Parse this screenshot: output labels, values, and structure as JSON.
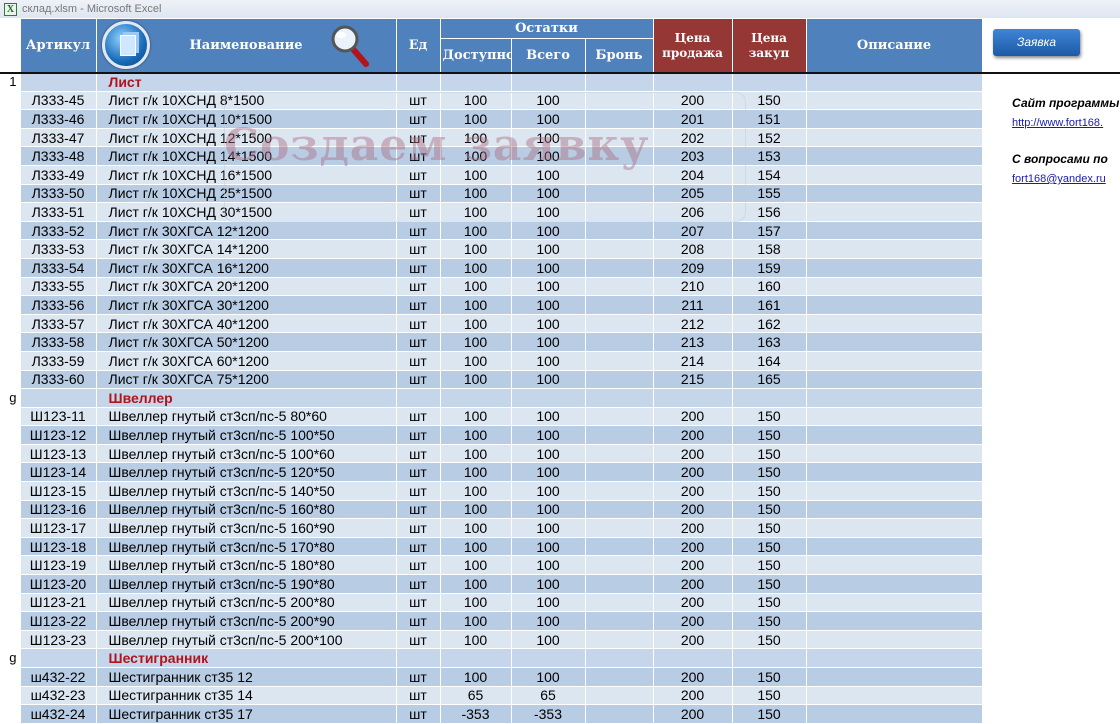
{
  "window": {
    "title": "склад.xlsm - Microsoft Excel",
    "icon": "excel-icon"
  },
  "header": {
    "article": "Артикул",
    "name": "Наименование",
    "unit": "Ед",
    "stock": "Остатки",
    "available": "Доступно",
    "total": "Всего",
    "reserve": "Бронь",
    "price_sell": "Цена продажа",
    "price_buy": "Цена закуп",
    "description": "Описание"
  },
  "watermark": "Создаем заявку",
  "side": {
    "order_button": "Заявка",
    "site_label": "Сайт программы",
    "site_link": "http://www.fort168.",
    "questions_label": "С вопросами по",
    "email": "fort168@yandex.ru"
  },
  "groups": [
    {
      "num": "1",
      "title": "Лист",
      "rows": [
        [
          "Л333-45",
          "Лист г/к  10ХСНД 8*1500",
          "шт",
          "100",
          "100",
          "",
          "200",
          "150"
        ],
        [
          "Л333-46",
          "Лист г/к  10ХСНД 10*1500",
          "шт",
          "100",
          "100",
          "",
          "201",
          "151"
        ],
        [
          "Л333-47",
          "Лист г/к  10ХСНД 12*1500",
          "шт",
          "100",
          "100",
          "",
          "202",
          "152"
        ],
        [
          "Л333-48",
          "Лист г/к  10ХСНД 14*1500",
          "шт",
          "100",
          "100",
          "",
          "203",
          "153"
        ],
        [
          "Л333-49",
          "Лист г/к  10ХСНД 16*1500",
          "шт",
          "100",
          "100",
          "",
          "204",
          "154"
        ],
        [
          "Л333-50",
          "Лист г/к  10ХСНД 25*1500",
          "шт",
          "100",
          "100",
          "",
          "205",
          "155"
        ],
        [
          "Л333-51",
          "Лист г/к  10ХСНД 30*1500",
          "шт",
          "100",
          "100",
          "",
          "206",
          "156"
        ],
        [
          "Л333-52",
          "Лист г/к  30ХГСА 12*1200",
          "шт",
          "100",
          "100",
          "",
          "207",
          "157"
        ],
        [
          "Л333-53",
          "Лист г/к  30ХГСА 14*1200",
          "шт",
          "100",
          "100",
          "",
          "208",
          "158"
        ],
        [
          "Л333-54",
          "Лист г/к  30ХГСА 16*1200",
          "шт",
          "100",
          "100",
          "",
          "209",
          "159"
        ],
        [
          "Л333-55",
          "Лист г/к  30ХГСА 20*1200",
          "шт",
          "100",
          "100",
          "",
          "210",
          "160"
        ],
        [
          "Л333-56",
          "Лист г/к  30ХГСА 30*1200",
          "шт",
          "100",
          "100",
          "",
          "211",
          "161"
        ],
        [
          "Л333-57",
          "Лист г/к  30ХГСА 40*1200",
          "шт",
          "100",
          "100",
          "",
          "212",
          "162"
        ],
        [
          "Л333-58",
          "Лист г/к  30ХГСА 50*1200",
          "шт",
          "100",
          "100",
          "",
          "213",
          "163"
        ],
        [
          "Л333-59",
          "Лист г/к  30ХГСА 60*1200",
          "шт",
          "100",
          "100",
          "",
          "214",
          "164"
        ],
        [
          "Л333-60",
          "Лист г/к  30ХГСА 75*1200",
          "шт",
          "100",
          "100",
          "",
          "215",
          "165"
        ]
      ]
    },
    {
      "num": "g",
      "title": "Швеллер",
      "rows": [
        [
          "Ш123-11",
          "Швеллер гнутый  ст3сп/пс-5 80*60",
          "шт",
          "100",
          "100",
          "",
          "200",
          "150"
        ],
        [
          "Ш123-12",
          "Швеллер гнутый  ст3сп/пс-5 100*50",
          "шт",
          "100",
          "100",
          "",
          "200",
          "150"
        ],
        [
          "Ш123-13",
          "Швеллер гнутый  ст3сп/пс-5 100*60",
          "шт",
          "100",
          "100",
          "",
          "200",
          "150"
        ],
        [
          "Ш123-14",
          "Швеллер гнутый  ст3сп/пс-5 120*50",
          "шт",
          "100",
          "100",
          "",
          "200",
          "150"
        ],
        [
          "Ш123-15",
          "Швеллер гнутый  ст3сп/пс-5 140*50",
          "шт",
          "100",
          "100",
          "",
          "200",
          "150"
        ],
        [
          "Ш123-16",
          "Швеллер гнутый  ст3сп/пс-5 160*80",
          "шт",
          "100",
          "100",
          "",
          "200",
          "150"
        ],
        [
          "Ш123-17",
          "Швеллер гнутый  ст3сп/пс-5 160*90",
          "шт",
          "100",
          "100",
          "",
          "200",
          "150"
        ],
        [
          "Ш123-18",
          "Швеллер гнутый  ст3сп/пс-5 170*80",
          "шт",
          "100",
          "100",
          "",
          "200",
          "150"
        ],
        [
          "Ш123-19",
          "Швеллер гнутый  ст3сп/пс-5 180*80",
          "шт",
          "100",
          "100",
          "",
          "200",
          "150"
        ],
        [
          "Ш123-20",
          "Швеллер гнутый  ст3сп/пс-5 190*80",
          "шт",
          "100",
          "100",
          "",
          "200",
          "150"
        ],
        [
          "Ш123-21",
          "Швеллер гнутый  ст3сп/пс-5 200*80",
          "шт",
          "100",
          "100",
          "",
          "200",
          "150"
        ],
        [
          "Ш123-22",
          "Швеллер гнутый  ст3сп/пс-5 200*90",
          "шт",
          "100",
          "100",
          "",
          "200",
          "150"
        ],
        [
          "Ш123-23",
          "Швеллер гнутый  ст3сп/пс-5 200*100",
          "шт",
          "100",
          "100",
          "",
          "200",
          "150"
        ]
      ]
    },
    {
      "num": "g",
      "title": "Шестигранник",
      "rows": [
        [
          "ш432-22",
          "Шестигранник  ст35 12",
          "шт",
          "100",
          "100",
          "",
          "200",
          "150"
        ],
        [
          "ш432-23",
          "Шестигранник  ст35 14",
          "шт",
          "65",
          "65",
          "",
          "200",
          "150"
        ],
        [
          "ш432-24",
          "Шестигранник  ст35 17",
          "шт",
          "-353",
          "-353",
          "",
          "200",
          "150"
        ]
      ]
    }
  ]
}
